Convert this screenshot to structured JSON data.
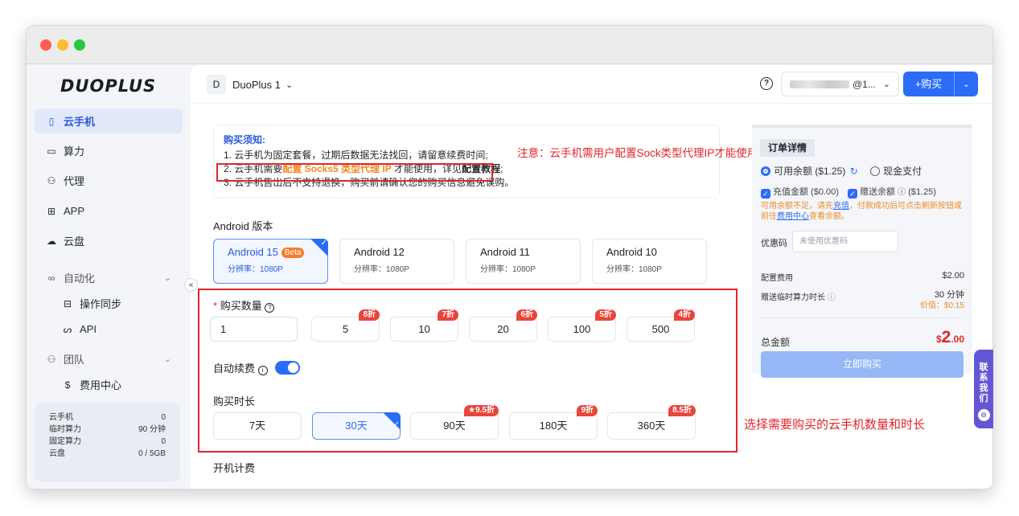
{
  "sidebar": {
    "logo": "DUOPLUS",
    "items": [
      {
        "label": "云手机",
        "icon": "phone-icon"
      },
      {
        "label": "算力",
        "icon": "monitor-icon"
      },
      {
        "label": "代理",
        "icon": "network-icon"
      },
      {
        "label": "APP",
        "icon": "apps-grid-icon"
      },
      {
        "label": "云盘",
        "icon": "cloud-icon"
      }
    ],
    "automation": {
      "label": "自动化",
      "icon": "infinity-icon",
      "children": [
        {
          "label": "操作同步",
          "icon": "sync-icon"
        },
        {
          "label": "API",
          "icon": "api-icon"
        }
      ]
    },
    "team": {
      "label": "团队",
      "icon": "team-icon",
      "children": [
        {
          "label": "费用中心",
          "icon": "dollar-icon"
        }
      ]
    },
    "stats": [
      {
        "label": "云手机",
        "value": "0"
      },
      {
        "label": "临时算力",
        "value": "90 分钟"
      },
      {
        "label": "固定算力",
        "value": "0"
      },
      {
        "label": "云盘",
        "value": "0 / 5GB"
      }
    ]
  },
  "header": {
    "workspace_badge": "D",
    "workspace": "DuoPlus 1",
    "account": "@1...",
    "buy_label": "+购买"
  },
  "notice": {
    "title": "购买须知:",
    "line1": "1. 云手机为固定套餐，过期后数据无法找回，请留意续费时间;",
    "line2_pre": "2. 云手机需要",
    "line2_hl": "配置 Socks5 类型代理 IP",
    "line2_mid": " 才能使用，详见",
    "line2_link": "配置教程",
    "line2_end": ";",
    "line3": "3. 云手机售出后不支持退换，购买前请确认您的购买信息避免误购。"
  },
  "annotations": {
    "note1": "注意：云手机需用户配置Sock类型代理IP才能使用",
    "note2": "选择需要购买的云手机数量和时长"
  },
  "android": {
    "label": "Android 版本",
    "beta": "Beta",
    "versions": [
      {
        "name": "Android 15",
        "res": "分辨率：1080P"
      },
      {
        "name": "Android 12",
        "res": "分辨率：1080P"
      },
      {
        "name": "Android 11",
        "res": "分辨率：1080P"
      },
      {
        "name": "Android 10",
        "res": "分辨率：1080P"
      }
    ]
  },
  "quantity": {
    "label": "购买数量",
    "required_mark": "*",
    "value": "1",
    "options": [
      {
        "value": "5",
        "discount": "8折"
      },
      {
        "value": "10",
        "discount": "7折"
      },
      {
        "value": "20",
        "discount": "6折"
      },
      {
        "value": "100",
        "discount": "5折"
      },
      {
        "value": "500",
        "discount": "4折"
      }
    ]
  },
  "auto_renew": {
    "label": "自动续费",
    "enabled": true
  },
  "duration": {
    "label": "购买时长",
    "selected": "30天",
    "options": [
      {
        "value": "7天",
        "discount": ""
      },
      {
        "value": "30天",
        "discount": ""
      },
      {
        "value": "90天",
        "discount": "9.5折"
      },
      {
        "value": "180天",
        "discount": "9折"
      },
      {
        "value": "360天",
        "discount": "8.5折"
      }
    ]
  },
  "billing_label": "开机计费",
  "order": {
    "title": "订单详情",
    "balance_label": "可用余额 ($1.25)",
    "cash_label": "现金支付",
    "recharge_label": "充值金额 ($0.00)",
    "gift_label": "赠送余额",
    "gift_value": "($1.25)",
    "warn_pre": "可用余额不足，请先",
    "warn_link1": "充值",
    "warn_mid": "，付款成功后可点击刷新按钮或前往",
    "warn_link2": "费用中心",
    "warn_end": "查看余额。",
    "coupon_label": "优惠码",
    "coupon_placeholder": "未使用优惠码",
    "config_label": "配置费用",
    "config_value": "$2.00",
    "gift_time_label": "赠送临时算力时长",
    "gift_time_value": "30 分钟",
    "gift_time_worth": "价值：$0.15",
    "total_label": "总金额",
    "total_currency": "$",
    "total_int": "2",
    "total_dec": ".00",
    "pay_label": "立即购买"
  },
  "contact_label": "联系我们",
  "colors": {
    "primary": "#2b6cf6",
    "accent_orange": "#f08a24",
    "discount_red": "#e8463b",
    "annotation_red": "#e0262a"
  }
}
